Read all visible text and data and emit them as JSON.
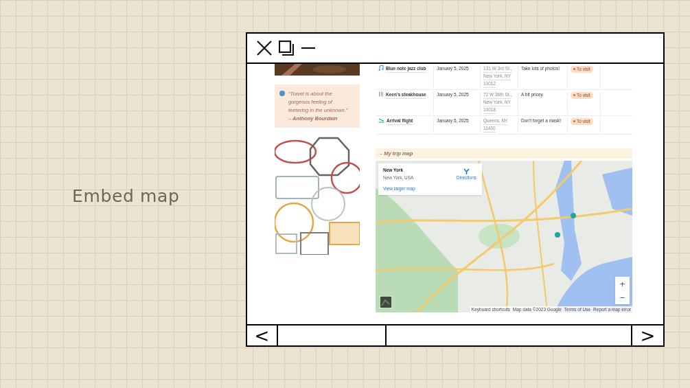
{
  "slide_title": "Embed map",
  "sidebar": {
    "quote": "“Travel is about the gorgeous feeling of teetering in the unknown.”",
    "author": "– Anthony Bourdain"
  },
  "table": {
    "rows": [
      {
        "kind": "music",
        "name": "Blue note jazz club",
        "date": "January 5, 2025",
        "address": [
          "131 W 3rd St.,",
          "New York, NY",
          "10012"
        ],
        "notes": "Take lots of photos!",
        "status": "To visit"
      },
      {
        "kind": "dining",
        "name": "Keen's steakhouse",
        "date": "January 5, 2025",
        "address": [
          "72 W 36th St.,",
          "New York, NY",
          "10018"
        ],
        "notes": "A bit pricey.",
        "status": "To visit"
      },
      {
        "kind": "arrival",
        "name": "Arrival flight",
        "date": "January 5, 2025",
        "address": [
          "Queens, NY",
          "11430"
        ],
        "notes": "Don't forget a mask!",
        "status": "To visit"
      }
    ]
  },
  "map": {
    "heading": "– My trip map",
    "place": {
      "name": "New York",
      "address": "New York, USA",
      "directions": "Directions",
      "link": "View larger map"
    },
    "zoom": [
      "+",
      "−"
    ],
    "attribution": [
      "Keyboard shortcuts",
      "Map data ©2023 Google",
      "Terms of Use",
      "Report a map error"
    ]
  },
  "nav": {
    "back": "<",
    "forward": ">"
  }
}
